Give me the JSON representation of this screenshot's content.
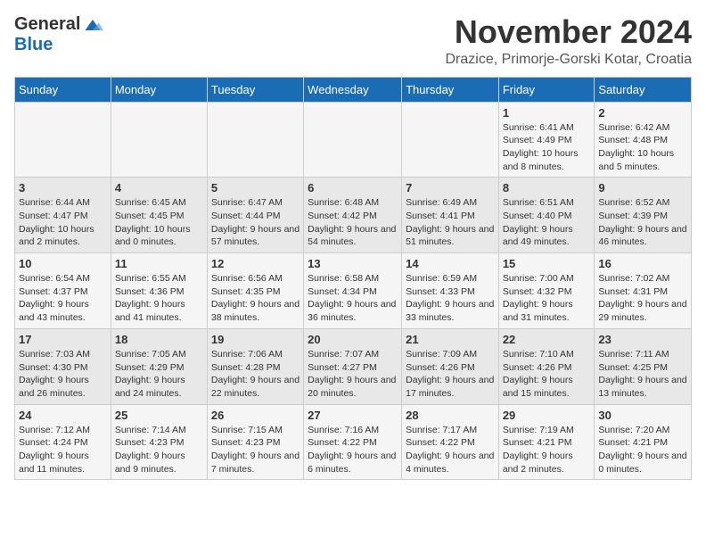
{
  "logo": {
    "general": "General",
    "blue": "Blue"
  },
  "title": "November 2024",
  "location": "Drazice, Primorje-Gorski Kotar, Croatia",
  "days_header": [
    "Sunday",
    "Monday",
    "Tuesday",
    "Wednesday",
    "Thursday",
    "Friday",
    "Saturday"
  ],
  "weeks": [
    [
      {
        "day": "",
        "info": ""
      },
      {
        "day": "",
        "info": ""
      },
      {
        "day": "",
        "info": ""
      },
      {
        "day": "",
        "info": ""
      },
      {
        "day": "",
        "info": ""
      },
      {
        "day": "1",
        "info": "Sunrise: 6:41 AM\nSunset: 4:49 PM\nDaylight: 10 hours and 8 minutes."
      },
      {
        "day": "2",
        "info": "Sunrise: 6:42 AM\nSunset: 4:48 PM\nDaylight: 10 hours and 5 minutes."
      }
    ],
    [
      {
        "day": "3",
        "info": "Sunrise: 6:44 AM\nSunset: 4:47 PM\nDaylight: 10 hours and 2 minutes."
      },
      {
        "day": "4",
        "info": "Sunrise: 6:45 AM\nSunset: 4:45 PM\nDaylight: 10 hours and 0 minutes."
      },
      {
        "day": "5",
        "info": "Sunrise: 6:47 AM\nSunset: 4:44 PM\nDaylight: 9 hours and 57 minutes."
      },
      {
        "day": "6",
        "info": "Sunrise: 6:48 AM\nSunset: 4:42 PM\nDaylight: 9 hours and 54 minutes."
      },
      {
        "day": "7",
        "info": "Sunrise: 6:49 AM\nSunset: 4:41 PM\nDaylight: 9 hours and 51 minutes."
      },
      {
        "day": "8",
        "info": "Sunrise: 6:51 AM\nSunset: 4:40 PM\nDaylight: 9 hours and 49 minutes."
      },
      {
        "day": "9",
        "info": "Sunrise: 6:52 AM\nSunset: 4:39 PM\nDaylight: 9 hours and 46 minutes."
      }
    ],
    [
      {
        "day": "10",
        "info": "Sunrise: 6:54 AM\nSunset: 4:37 PM\nDaylight: 9 hours and 43 minutes."
      },
      {
        "day": "11",
        "info": "Sunrise: 6:55 AM\nSunset: 4:36 PM\nDaylight: 9 hours and 41 minutes."
      },
      {
        "day": "12",
        "info": "Sunrise: 6:56 AM\nSunset: 4:35 PM\nDaylight: 9 hours and 38 minutes."
      },
      {
        "day": "13",
        "info": "Sunrise: 6:58 AM\nSunset: 4:34 PM\nDaylight: 9 hours and 36 minutes."
      },
      {
        "day": "14",
        "info": "Sunrise: 6:59 AM\nSunset: 4:33 PM\nDaylight: 9 hours and 33 minutes."
      },
      {
        "day": "15",
        "info": "Sunrise: 7:00 AM\nSunset: 4:32 PM\nDaylight: 9 hours and 31 minutes."
      },
      {
        "day": "16",
        "info": "Sunrise: 7:02 AM\nSunset: 4:31 PM\nDaylight: 9 hours and 29 minutes."
      }
    ],
    [
      {
        "day": "17",
        "info": "Sunrise: 7:03 AM\nSunset: 4:30 PM\nDaylight: 9 hours and 26 minutes."
      },
      {
        "day": "18",
        "info": "Sunrise: 7:05 AM\nSunset: 4:29 PM\nDaylight: 9 hours and 24 minutes."
      },
      {
        "day": "19",
        "info": "Sunrise: 7:06 AM\nSunset: 4:28 PM\nDaylight: 9 hours and 22 minutes."
      },
      {
        "day": "20",
        "info": "Sunrise: 7:07 AM\nSunset: 4:27 PM\nDaylight: 9 hours and 20 minutes."
      },
      {
        "day": "21",
        "info": "Sunrise: 7:09 AM\nSunset: 4:26 PM\nDaylight: 9 hours and 17 minutes."
      },
      {
        "day": "22",
        "info": "Sunrise: 7:10 AM\nSunset: 4:26 PM\nDaylight: 9 hours and 15 minutes."
      },
      {
        "day": "23",
        "info": "Sunrise: 7:11 AM\nSunset: 4:25 PM\nDaylight: 9 hours and 13 minutes."
      }
    ],
    [
      {
        "day": "24",
        "info": "Sunrise: 7:12 AM\nSunset: 4:24 PM\nDaylight: 9 hours and 11 minutes."
      },
      {
        "day": "25",
        "info": "Sunrise: 7:14 AM\nSunset: 4:23 PM\nDaylight: 9 hours and 9 minutes."
      },
      {
        "day": "26",
        "info": "Sunrise: 7:15 AM\nSunset: 4:23 PM\nDaylight: 9 hours and 7 minutes."
      },
      {
        "day": "27",
        "info": "Sunrise: 7:16 AM\nSunset: 4:22 PM\nDaylight: 9 hours and 6 minutes."
      },
      {
        "day": "28",
        "info": "Sunrise: 7:17 AM\nSunset: 4:22 PM\nDaylight: 9 hours and 4 minutes."
      },
      {
        "day": "29",
        "info": "Sunrise: 7:19 AM\nSunset: 4:21 PM\nDaylight: 9 hours and 2 minutes."
      },
      {
        "day": "30",
        "info": "Sunrise: 7:20 AM\nSunset: 4:21 PM\nDaylight: 9 hours and 0 minutes."
      }
    ]
  ]
}
